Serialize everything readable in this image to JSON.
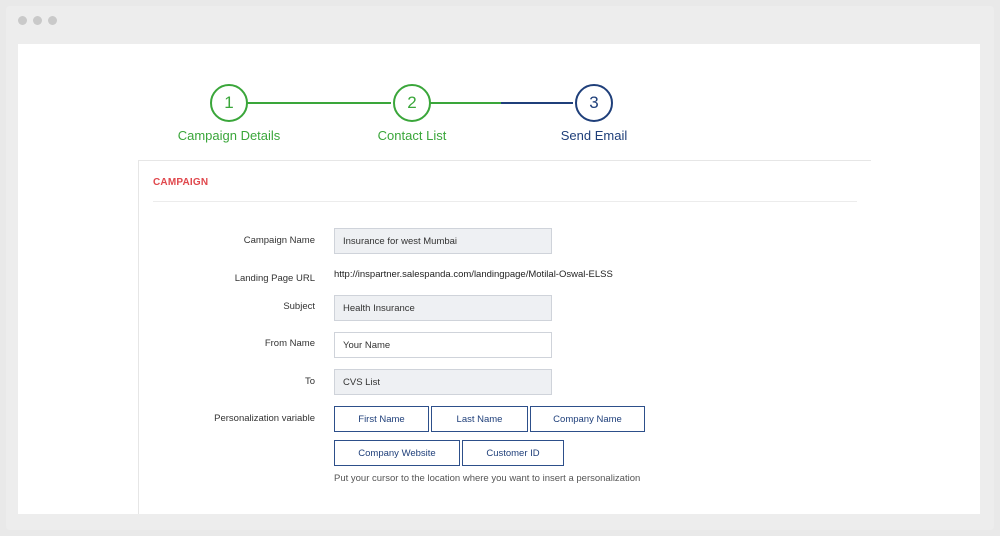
{
  "steps": [
    {
      "number": "1",
      "label": "Campaign Details"
    },
    {
      "number": "2",
      "label": "Contact List"
    },
    {
      "number": "3",
      "label": "Send Email"
    }
  ],
  "campaign": {
    "section_title": "CAMPAIGN",
    "campaign_name_label": "Campaign Name",
    "campaign_name_value": "Insurance for west Mumbai",
    "landing_url_label": "Landing Page URL",
    "landing_url_value": "http://inspartner.salespanda.com/landingpage/Motilal-Oswal-ELSS",
    "subject_label": "Subject",
    "subject_value": "Health Insurance",
    "from_name_label": "From Name",
    "from_name_placeholder": "Your Name",
    "to_label": "To",
    "to_value": "CVS List",
    "personalization_label": "Personalization variable",
    "personalization_buttons": [
      "First Name",
      "Last Name",
      "Company Name",
      "Company Website",
      "Customer ID"
    ],
    "hint": "Put your cursor to the location where you want to insert a personalization"
  },
  "colors": {
    "complete": "#3aa63a",
    "active": "#1f3f7a",
    "section_title": "#e0474c"
  }
}
